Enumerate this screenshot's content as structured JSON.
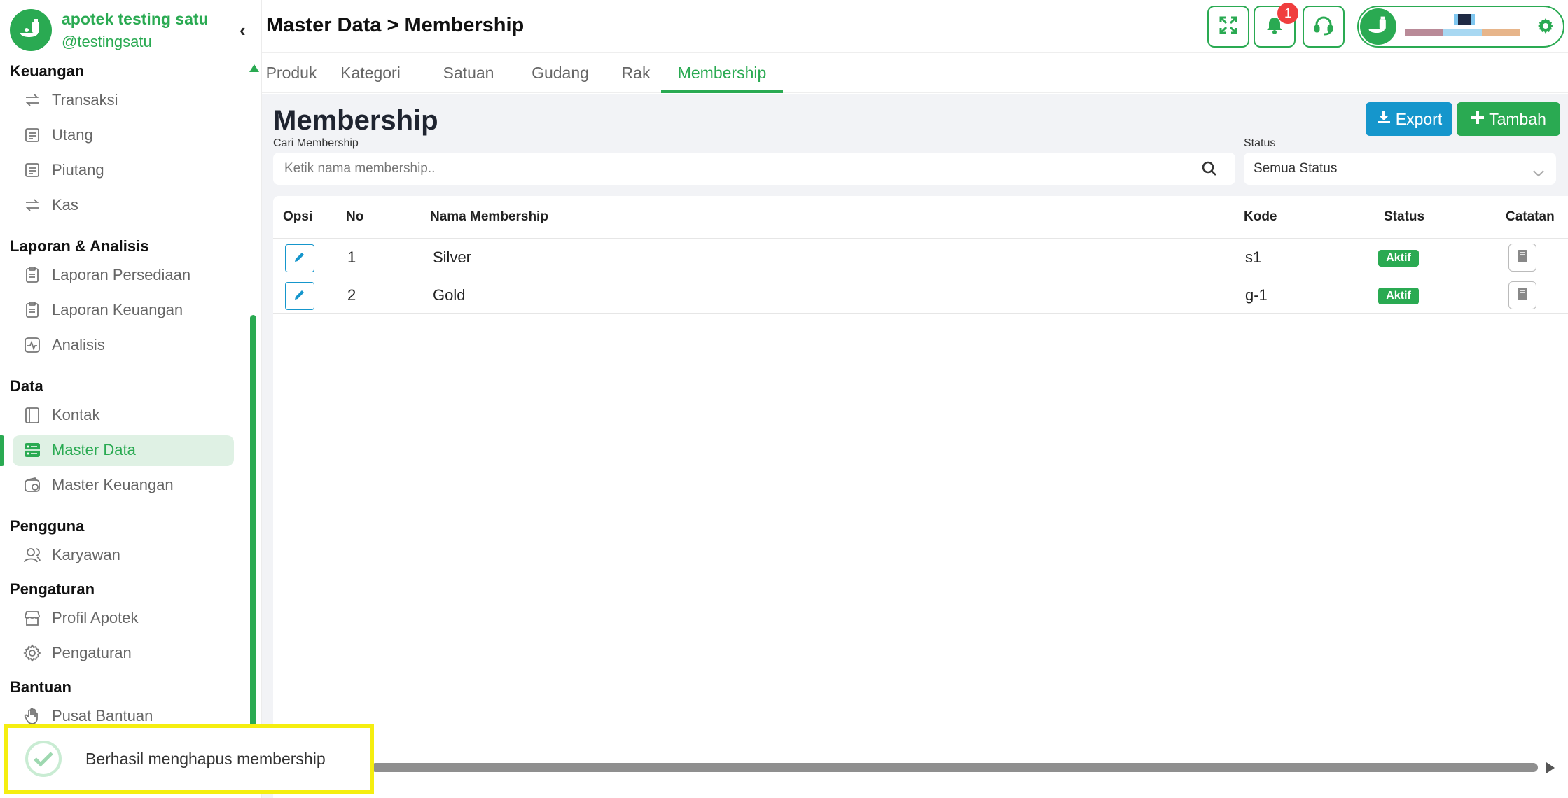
{
  "brand": {
    "name": "apotek testing satu",
    "handle": "@testingsatu"
  },
  "sidebar": {
    "groups": [
      {
        "title": "Keuangan",
        "items": [
          {
            "label": "Transaksi",
            "icon": "transfer-icon"
          },
          {
            "label": "Utang",
            "icon": "receipt-icon"
          },
          {
            "label": "Piutang",
            "icon": "receipt-icon"
          },
          {
            "label": "Kas",
            "icon": "transfer-icon"
          }
        ]
      },
      {
        "title": "Laporan & Analisis",
        "items": [
          {
            "label": "Laporan Persediaan",
            "icon": "clipboard-icon"
          },
          {
            "label": "Laporan Keuangan",
            "icon": "clipboard-icon"
          },
          {
            "label": "Analisis",
            "icon": "activity-icon"
          }
        ]
      },
      {
        "title": "Data",
        "items": [
          {
            "label": "Kontak",
            "icon": "contact-book-icon"
          },
          {
            "label": "Master Data",
            "icon": "server-icon",
            "active": true
          },
          {
            "label": "Master Keuangan",
            "icon": "wallet-icon"
          }
        ]
      },
      {
        "title": "Pengguna",
        "items": [
          {
            "label": "Karyawan",
            "icon": "users-icon"
          }
        ]
      },
      {
        "title": "Pengaturan",
        "items": [
          {
            "label": "Profil Apotek",
            "icon": "store-icon"
          },
          {
            "label": "Pengaturan",
            "icon": "gear-icon"
          }
        ]
      },
      {
        "title": "Bantuan",
        "items": [
          {
            "label": "Pusat Bantuan",
            "icon": "hand-icon"
          }
        ]
      }
    ]
  },
  "header": {
    "breadcrumb": "Master Data > Membership",
    "notification_count": "1"
  },
  "tabs": [
    {
      "label": "Produk"
    },
    {
      "label": "Kategori"
    },
    {
      "label": "Satuan"
    },
    {
      "label": "Gudang"
    },
    {
      "label": "Rak"
    },
    {
      "label": "Membership",
      "active": true
    }
  ],
  "page": {
    "title": "Membership",
    "export_label": "Export",
    "add_label": "Tambah",
    "search_label": "Cari Membership",
    "search_placeholder": "Ketik nama membership..",
    "status_label": "Status",
    "status_value": "Semua Status"
  },
  "table": {
    "columns": [
      "Opsi",
      "No",
      "Nama Membership",
      "Kode",
      "Status",
      "Catatan"
    ],
    "rows": [
      {
        "no": "1",
        "name": "Silver",
        "code": "s1",
        "status": "Aktif"
      },
      {
        "no": "2",
        "name": "Gold",
        "code": "g-1",
        "status": "Aktif"
      }
    ]
  },
  "toast": {
    "message": "Berhasil menghapus membership"
  },
  "colors": {
    "accent": "#2aaa52",
    "export": "#1596cc",
    "badge": "#2aaa52",
    "toast_border": "#f5ee10"
  }
}
